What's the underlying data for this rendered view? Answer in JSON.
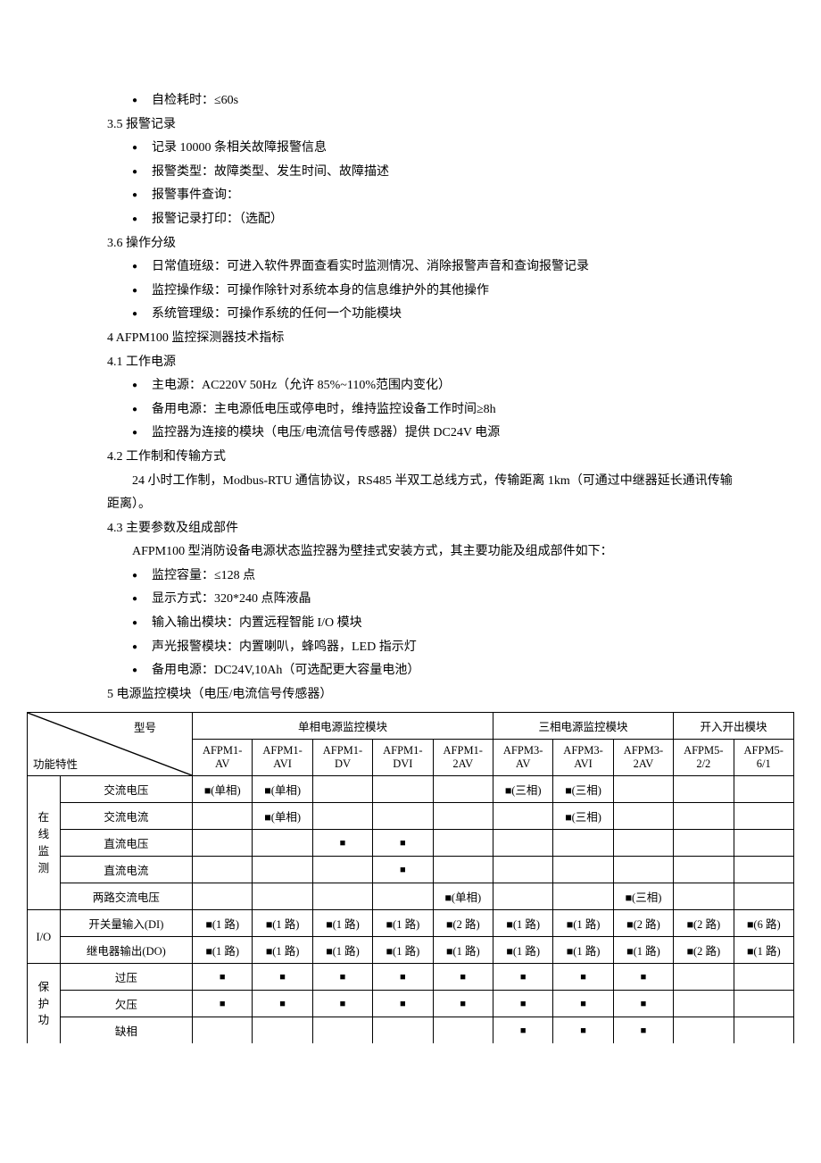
{
  "lines": {
    "b1": "自检耗时：≤60s",
    "s35": "3.5 报警记录",
    "b2": "记录 10000 条相关故障报警信息",
    "b3": "报警类型：故障类型、发生时间、故障描述",
    "b4": "报警事件查询：",
    "b5": "报警记录打印：（选配）",
    "s36": "3.6 操作分级",
    "b6": "日常值班级：可进入软件界面查看实时监测情况、消除报警声音和查询报警记录",
    "b7": "监控操作级：可操作除针对系统本身的信息维护外的其他操作",
    "b8": "系统管理级：可操作系统的任何一个功能模块",
    "s4": "4   AFPM100 监控探测器技术指标",
    "s41": "4.1 工作电源",
    "b9": "主电源：AC220V 50Hz（允许 85%~110%范围内变化）",
    "b10": "备用电源：主电源低电压或停电时，维持监控设备工作时间≥8h",
    "b11": "监控器为连接的模块（电压/电流信号传感器）提供 DC24V 电源",
    "s42": "4.2 工作制和传输方式",
    "p1": "24 小时工作制，Modbus-RTU 通信协议，RS485 半双工总线方式，传输距离 1km（可通过中继器延长通讯传输距离）。",
    "s43": "4.3 主要参数及组成部件",
    "p2": "AFPM100 型消防设备电源状态监控器为壁挂式安装方式，其主要功能及组成部件如下：",
    "b12": "监控容量：≤128 点",
    "b13": "显示方式：320*240 点阵液晶",
    "b14": "输入输出模块：内置远程智能 I/O 模块",
    "b15": "声光报警模块：内置喇叭，蜂鸣器，LED 指示灯",
    "b16": "备用电源：DC24V,10Ah（可选配更大容量电池）",
    "s5": "5 电源监控模块（电压/电流信号传感器）"
  },
  "table": {
    "diag_top": "型号",
    "diag_bottom": "功能特性",
    "group1": "单相电源监控模块",
    "group2": "三相电源监控模块",
    "group3": "开入开出模块",
    "cols": {
      "c1a": "AFPM1-",
      "c1b": "AV",
      "c2a": "AFPM1-",
      "c2b": "AVI",
      "c3a": "AFPM1-",
      "c3b": "DV",
      "c4a": "AFPM1-",
      "c4b": "DVI",
      "c5a": "AFPM1-",
      "c5b": "2AV",
      "c6a": "AFPM3-",
      "c6b": "AV",
      "c7a": "AFPM3-",
      "c7b": "AVI",
      "c8a": "AFPM3-",
      "c8b": "2AV",
      "c9a": "AFPM5-",
      "c9b": "2/2",
      "c10a": "AFPM5-",
      "c10b": "6/1"
    },
    "cat_online": "在线监测",
    "row_acv": "交流电压",
    "row_aci": "交流电流",
    "row_dcv": "直流电压",
    "row_dci": "直流电流",
    "row_2acv": "两路交流电压",
    "cat_io": "I/O",
    "row_di": "开关量输入(DI)",
    "row_do": "继电器输出(DO)",
    "cat_prot": "保护功",
    "row_ov": "过压",
    "row_uv": "欠压",
    "row_ph": "缺相",
    "marks": {
      "sq": "■",
      "sp1": "■(单相)",
      "sp3": "■(三相)",
      "r1": "■(1 路)",
      "r2": "■(2 路)",
      "r6": "■(6 路)"
    }
  }
}
